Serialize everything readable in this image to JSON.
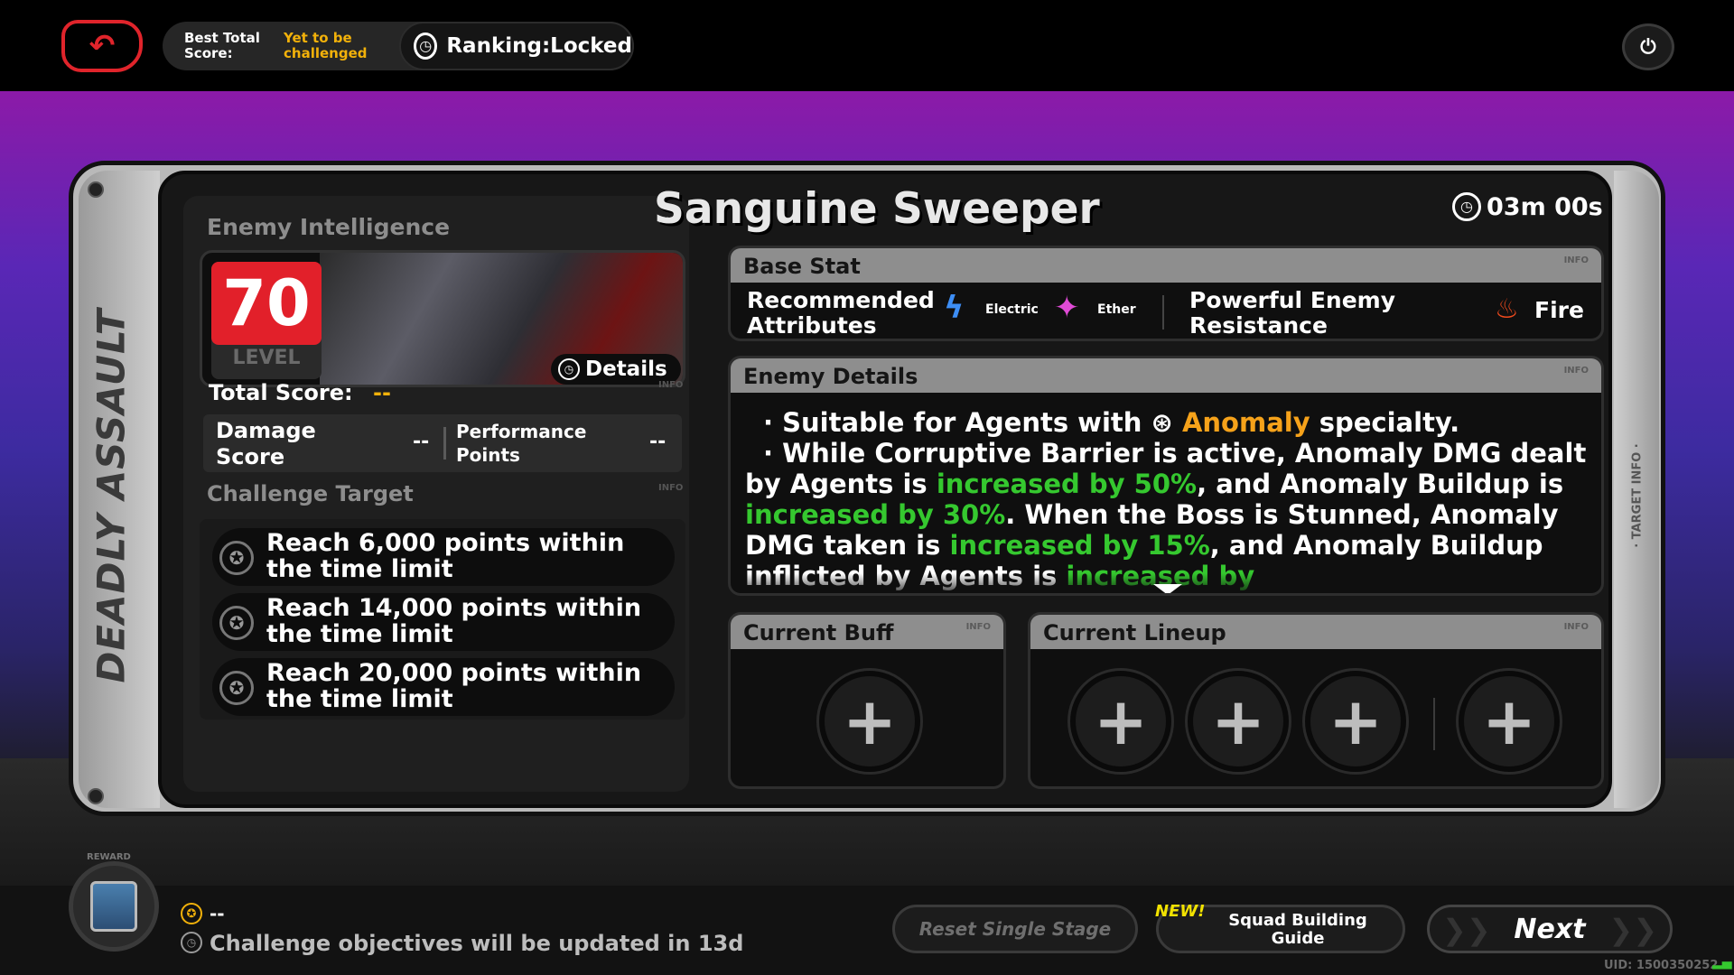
{
  "topbar": {
    "best_total_score_label": "Best Total Score:",
    "best_total_score_value": "Yet to be challenged",
    "ranking_label": "Ranking:Locked"
  },
  "spine_text": "DEADLY ASSAULT",
  "side_rail_text": "· TARGET INFO ·",
  "enemy_intelligence": {
    "title": "Enemy Intelligence",
    "info": "INFO",
    "level": "70",
    "level_label": "LEVEL",
    "details_label": "Details"
  },
  "score": {
    "total_label": "Total Score:",
    "total_value": "--",
    "info": "INFO",
    "damage_label": "Damage Score",
    "damage_value": "--",
    "performance_label": "Performance Points",
    "performance_value": "--"
  },
  "challenge": {
    "title": "Challenge Target",
    "info": "INFO",
    "targets": [
      "Reach 6,000 points within the time limit",
      "Reach 14,000 points within the time limit",
      "Reach 20,000 points within the time limit"
    ]
  },
  "boss": {
    "name": "Sanguine Sweeper",
    "timer": "03m 00s"
  },
  "base_stat": {
    "title": "Base Stat",
    "info": "INFO",
    "recommended_label": "Recommended Attributes",
    "attributes": [
      "Electric",
      "Ether"
    ],
    "resistance_label": "Powerful Enemy Resistance",
    "resistance_value": "Fire"
  },
  "enemy_details": {
    "title": "Enemy Details",
    "info": "INFO",
    "line1_pre": "Suitable for Agents with",
    "line1_hl": "Anomaly",
    "line1_post": "specialty.",
    "line2_a": "While Corruptive Barrier is active, Anomaly DMG dealt by Agents is",
    "line2_hl1": "increased by 50%",
    "line2_b": ", and Anomaly Buildup is",
    "line2_hl2": "increased by 30%",
    "line2_c": ". When the Boss is Stunned, Anomaly DMG taken is",
    "line2_hl3": "increased by 15%",
    "line2_d": ", and Anomaly Buildup inflicted by Agents is",
    "line2_hl4": "increased by"
  },
  "current_buff": {
    "title": "Current Buff",
    "info": "INFO"
  },
  "current_lineup": {
    "title": "Current Lineup",
    "info": "INFO"
  },
  "bottom": {
    "reward_label": "REWARD",
    "coin_value": "--",
    "update_text": "Challenge objectives will be updated in",
    "update_days": "13d",
    "reset_label": "Reset Single Stage",
    "new_badge": "NEW!",
    "squad_label": "Squad Building Guide",
    "next_label": "Next",
    "uid": "UID: 1500350252"
  },
  "colors": {
    "accent_red": "#e2202a",
    "accent_orange": "#f6a21a",
    "accent_green": "#35c82f",
    "gold": "#f2b10a"
  }
}
